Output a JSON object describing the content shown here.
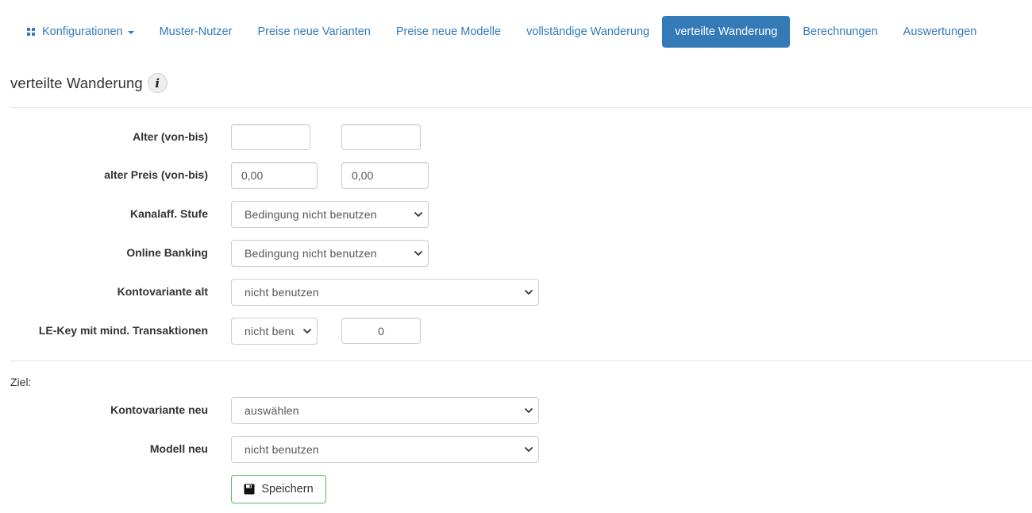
{
  "nav": {
    "items": [
      {
        "label": "Konfigurationen",
        "icon": "grid-icon",
        "dropdown": true
      },
      {
        "label": "Muster-Nutzer"
      },
      {
        "label": "Preise neue Varianten"
      },
      {
        "label": "Preise neue Modelle"
      },
      {
        "label": "vollständige Wanderung"
      },
      {
        "label": "verteilte Wanderung",
        "active": true
      },
      {
        "label": "Berechnungen"
      },
      {
        "label": "Auswertungen"
      }
    ]
  },
  "page": {
    "title": "verteilte Wanderung",
    "info_icon": "i"
  },
  "form": {
    "alter": {
      "label": "Alter (von-bis)",
      "from_value": "",
      "to_value": ""
    },
    "preis": {
      "label": "alter Preis (von-bis)",
      "from_value": "0,00",
      "to_value": "0,00"
    },
    "kanalaff": {
      "label": "Kanalaff. Stufe",
      "selected": "Bedingung nicht benutzen"
    },
    "online_banking": {
      "label": "Online Banking",
      "selected": "Bedingung nicht benutzen"
    },
    "kontovariante_alt": {
      "label": "Kontovariante alt",
      "selected": "nicht benutzen"
    },
    "lekey": {
      "label": "LE-Key mit mind. Transaktionen",
      "selected": "nicht benutzen",
      "count_value": "0"
    }
  },
  "ziel": {
    "heading": "Ziel:",
    "kontovariante_neu": {
      "label": "Kontovariante neu",
      "selected": "auswählen"
    },
    "modell_neu": {
      "label": "Modell neu",
      "selected": "nicht benutzen"
    }
  },
  "actions": {
    "save_label": "Speichern"
  },
  "colors": {
    "primary": "#337ab7",
    "success_border": "#5cb85c",
    "divider": "#e6e6e6"
  }
}
